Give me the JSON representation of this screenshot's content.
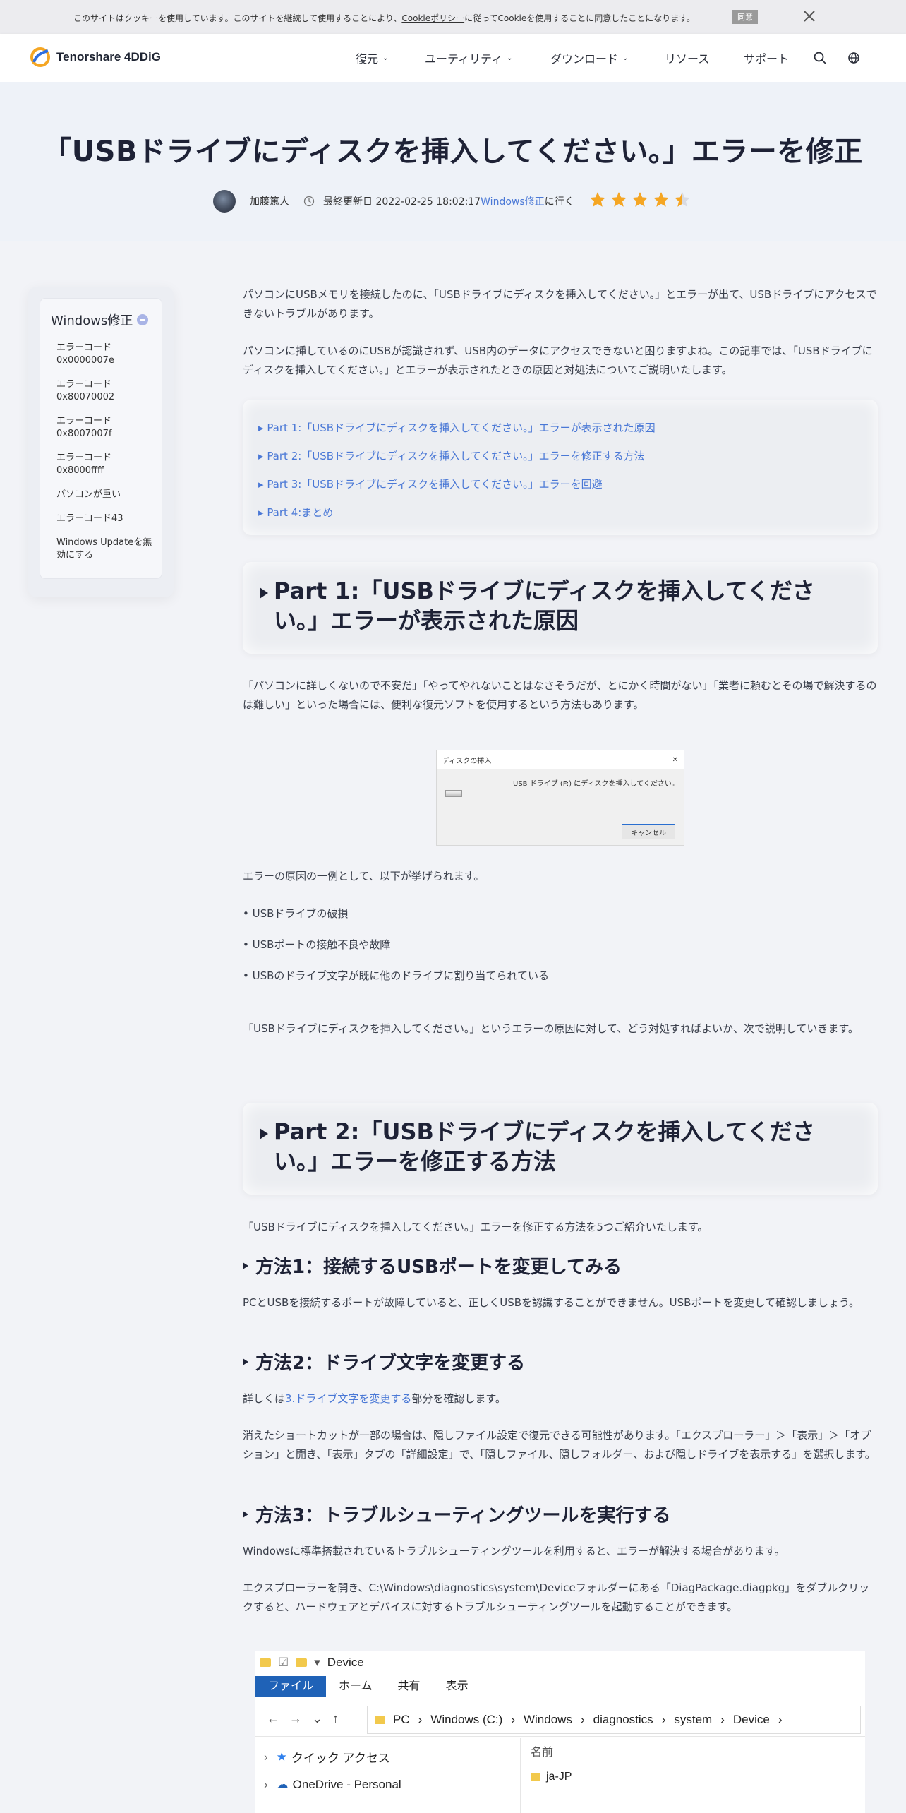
{
  "cookie": {
    "text_before": "このサイトはクッキーを使用しています。このサイトを継続して使用することにより、",
    "link": "Cookieポリシー",
    "text_after": "に従ってCookieを使用することに同意したことになります。",
    "agree": "同意"
  },
  "header": {
    "brand": "Tenorshare 4DDiG",
    "nav": [
      {
        "label": "復元",
        "dropdown": true
      },
      {
        "label": "ユーティリティ",
        "dropdown": true
      },
      {
        "label": "ダウンロード",
        "dropdown": true
      },
      {
        "label": "リソース",
        "dropdown": false
      },
      {
        "label": "サポート",
        "dropdown": false
      }
    ]
  },
  "hero": {
    "title": "「USBドライブにディスクを挿入してください。」エラーを修正",
    "author": "加藤篤人",
    "updated_label": "最終更新日 2022-02-25 18:02:17",
    "category_link": "Windows修正",
    "category_suffix": "に行く",
    "rating": 4.5
  },
  "sidebar": {
    "title": "Windows修正",
    "items": [
      "エラーコード0x0000007e",
      "エラーコード0x80070002",
      "エラーコード0x8007007f",
      "エラーコード0x8000ffff",
      "パソコンが重い",
      "エラーコード43",
      "Windows Updateを無効にする"
    ]
  },
  "intro": [
    "パソコンにUSBメモリを接続したのに、「USBドライブにディスクを挿入してください。」とエラーが出て、USBドライブにアクセスできないトラブルがあります。",
    "パソコンに挿しているのにUSBが認識されず、USB内のデータにアクセスできないと困りますよね。この記事では、「USBドライブにディスクを挿入してください。」とエラーが表示されたときの原因と対処法についてご説明いたします。"
  ],
  "toc": [
    "Part 1:「USBドライブにディスクを挿入してください。」エラーが表示された原因",
    "Part 2:「USBドライブにディスクを挿入してください。」エラーを修正する方法",
    "Part 3:「USBドライブにディスクを挿入してください。」エラーを回避",
    "Part 4:まとめ"
  ],
  "part1": {
    "title": "Part 1:「USBドライブにディスクを挿入してください。」エラーが表示された原因",
    "p1": "「パソコンに詳しくないので不安だ」「やってやれないことはなさそうだが、とにかく時間がない」「業者に頼むとその場で解決するのは難しい」といった場合には、便利な復元ソフトを使用するという方法もあります。",
    "dialog": {
      "title": "ディスクの挿入",
      "message": "USB ドライブ (F:) にディスクを挿入してください。",
      "cancel": "キャンセル"
    },
    "p2": "エラーの原因の一例として、以下が挙げられます。",
    "bullets": [
      "USBドライブの破損",
      "USBポートの接触不良や故障",
      "USBのドライブ文字が既に他のドライブに割り当てられている"
    ],
    "p3": "「USBドライブにディスクを挿入してください。」というエラーの原因に対して、どう対処すればよいか、次で説明していきます。"
  },
  "part2": {
    "title": "Part 2:「USBドライブにディスクを挿入してください。」エラーを修正する方法",
    "p1": "「USBドライブにディスクを挿入してください。」エラーを修正する方法を5つご紹介いたします。",
    "m1_title": "方法1：接続するUSBポートを変更してみる",
    "m1_text": "PCとUSBを接続するポートが故障していると、正しくUSBを認識することができません。USBポートを変更して確認しましょう。",
    "m2_title": "方法2：ドライブ文字を変更する",
    "m2_pre": "詳しくは",
    "m2_link": "3.ドライブ文字を変更する",
    "m2_post": "部分を確認します。",
    "m2_text": "消えたショートカットが一部の場合は、隠しファイル設定で復元できる可能性があります。「エクスプローラー」＞「表示」＞「オプション」と開き、「表示」タブの「詳細設定」で、「隠しファイル、隠しフォルダー、および隠しドライブを表示する」を選択します。",
    "m3_title": "方法3：トラブルシューティングツールを実行する",
    "m3_text1": "Windowsに標準搭載されているトラブルシューティングツールを利用すると、エラーが解決する場合があります。",
    "m3_text2": "エクスプローラーを開き、C:\\Windows\\diagnostics\\system\\Deviceフォルダーにある「DiagPackage.diagpkg」をダブルクリックすると、ハードウェアとデバイスに対するトラブルシューティングツールを起動することができます。"
  },
  "explorer": {
    "title": "Device",
    "tabs": [
      "ファイル",
      "ホーム",
      "共有",
      "表示"
    ],
    "path": [
      "PC",
      "Windows (C:)",
      "Windows",
      "diagnostics",
      "system",
      "Device"
    ],
    "left_items": [
      "クイック アクセス",
      "OneDrive - Personal"
    ],
    "column": "名前",
    "right_items": [
      "ja-JP"
    ]
  },
  "colors": {
    "accent": "#4a78d6",
    "star": "#f5a623",
    "heading": "#1e2236"
  }
}
